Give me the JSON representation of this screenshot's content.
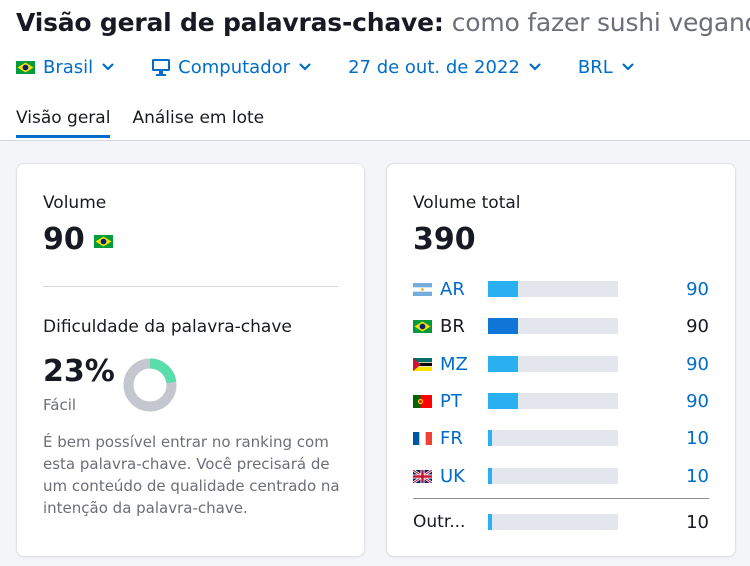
{
  "header": {
    "title_label": "Visão geral de palavras-chave:",
    "keyword": "como fazer sushi vegano"
  },
  "filters": {
    "country": "Brasil",
    "device": "Computador",
    "date": "27 de out. de 2022",
    "currency": "BRL"
  },
  "tabs": [
    {
      "label": "Visão geral",
      "active": true
    },
    {
      "label": "Análise em lote",
      "active": false
    }
  ],
  "volume_card": {
    "volume_label": "Volume",
    "volume_value": "90",
    "difficulty_label": "Dificuldade da palavra-chave",
    "difficulty_value": "23%",
    "difficulty_percent": 23,
    "difficulty_level": "Fácil",
    "description": "É bem possível entrar no ranking com esta palavra-chave. Você precisará de um conteúdo de qualidade centrado na intenção da palavra-chave."
  },
  "total_card": {
    "label": "Volume total",
    "value": "390",
    "countries": [
      {
        "code": "AR",
        "value": "90",
        "share": 0.23,
        "flag": "argentina-flag"
      },
      {
        "code": "BR",
        "value": "90",
        "share": 0.23,
        "flag": "brazil-flag"
      },
      {
        "code": "MZ",
        "value": "90",
        "share": 0.23,
        "flag": "mozambique-flag"
      },
      {
        "code": "PT",
        "value": "90",
        "share": 0.23,
        "flag": "portugal-flag"
      },
      {
        "code": "FR",
        "value": "10",
        "share": 0.03,
        "flag": "france-flag"
      },
      {
        "code": "UK",
        "value": "10",
        "share": 0.03,
        "flag": "uk-flag"
      }
    ],
    "other": {
      "label": "Outr...",
      "value": "10",
      "share": 0.03
    }
  },
  "colors": {
    "accent": "#006dca",
    "bar_fill": "#2ab0f0",
    "bar_fill_selected": "#0f75d6",
    "bar_track": "#e4e6ee",
    "difficulty_easy": "#59ddaa",
    "difficulty_track": "#c4c7cf"
  }
}
